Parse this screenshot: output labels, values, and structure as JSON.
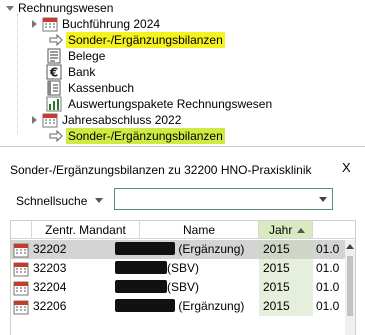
{
  "tree": {
    "items": [
      {
        "label": "Rechnungswesen",
        "highlight": false
      },
      {
        "label": "Buchführung 2024",
        "highlight": false
      },
      {
        "label": "Sonder-/Ergänzungsbilanzen",
        "highlight": true
      },
      {
        "label": "Belege",
        "highlight": false
      },
      {
        "label": "Bank",
        "highlight": false
      },
      {
        "label": "Kassenbuch",
        "highlight": false
      },
      {
        "label": "Auswertungspakete Rechnungswesen",
        "highlight": false
      },
      {
        "label": "Jahresabschluss 2022",
        "highlight": false
      },
      {
        "label": "Sonder-/Ergänzungsbilanzen",
        "highlight": true
      }
    ]
  },
  "dialog": {
    "title": "Sonder-/Ergänzungsbilanzen zu 32200 HNO-Praxisklinik",
    "close": "X",
    "search_label": "Schnellsuche",
    "search_value": ""
  },
  "grid": {
    "columns": [
      "Zentr. Mandant",
      "Name",
      "Jahr",
      ""
    ],
    "rows": [
      {
        "mandant": "32202",
        "name": "(Ergänzung)",
        "jahr": "2015",
        "extra": "01.0",
        "selected": true
      },
      {
        "mandant": "32203",
        "name": "(SBV)",
        "jahr": "2015",
        "extra": "01.0",
        "selected": false
      },
      {
        "mandant": "32204",
        "name": "(SBV)",
        "jahr": "2015",
        "extra": "01.0",
        "selected": false
      },
      {
        "mandant": "32206",
        "name": "(Ergänzung)",
        "jahr": "2015",
        "extra": "01.0",
        "selected": false
      }
    ]
  },
  "colors": {
    "highlight": "#f4f21f",
    "sorted_column": "#d8ebc0"
  }
}
